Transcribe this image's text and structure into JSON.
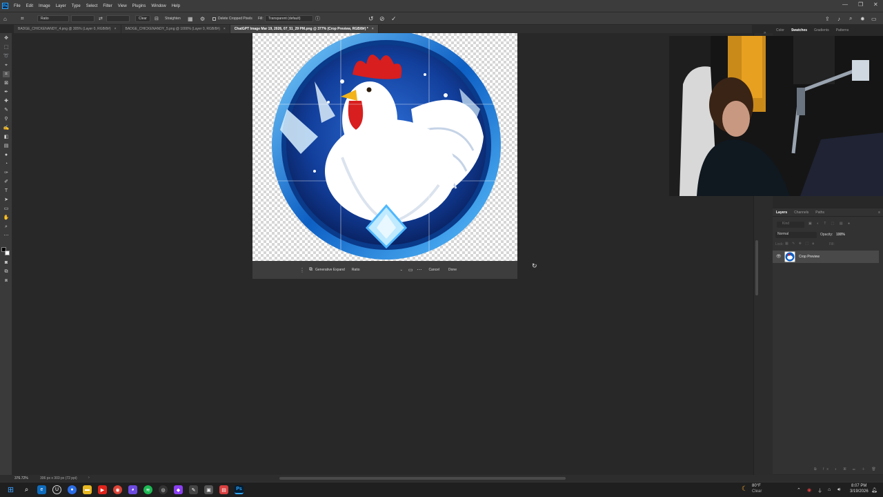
{
  "menubar": {
    "logo": "Ps",
    "items": [
      "File",
      "Edit",
      "Image",
      "Layer",
      "Type",
      "Select",
      "Filter",
      "View",
      "Plugins",
      "Window",
      "Help"
    ]
  },
  "options": {
    "ratio": "Ratio",
    "clear": "Clear",
    "straighten": "Straighten",
    "delete_cropped": "Delete Cropped Pixels",
    "fill_label": "Fill:",
    "fill_value": "Transparent (default)"
  },
  "tabs": [
    {
      "label": "BADGE_CHICKENANDY_4.png @ 305% (Layer 0, RGB/8#)",
      "close": "×"
    },
    {
      "label": "BADGE_CHICKENANDY_5.png @ 1000% (Layer 0, RGB/8#)",
      "close": "×"
    },
    {
      "label": "ChatGPT Image Mar 19, 2026, 07_51_29 PM.png @ 377% (Crop Preview, RGB/8#) *",
      "close": "×"
    }
  ],
  "context_bar": {
    "generative_expand": "Generative Expand",
    "ratio": "Ratio",
    "cancel": "Cancel",
    "done": "Done"
  },
  "panels_top": {
    "tabs": [
      "Color",
      "Swatches",
      "Gradients",
      "Patterns"
    ],
    "active": "Swatches"
  },
  "layers": {
    "tabs": [
      "Layers",
      "Channels",
      "Paths"
    ],
    "filter_placeholder": "Kind",
    "blend_mode": "Normal",
    "opacity_label": "Opacity:",
    "opacity_value": "100%",
    "lock_label": "Lock:",
    "fill_label": "Fill:",
    "layer_name": "Crop Preview"
  },
  "status": {
    "zoom": "376.72%",
    "dims": "306 px x 303 px (72 ppi)",
    "arrow": "›"
  },
  "taskbar": {
    "weather_temp": "80°F",
    "weather_desc": "Clear",
    "time": "8:07 PM",
    "date": "3/19/2026"
  },
  "colors": {
    "accent": "#31a8ff",
    "badge_blue": "#0d5fc4",
    "comb_red": "#d81e1e"
  }
}
